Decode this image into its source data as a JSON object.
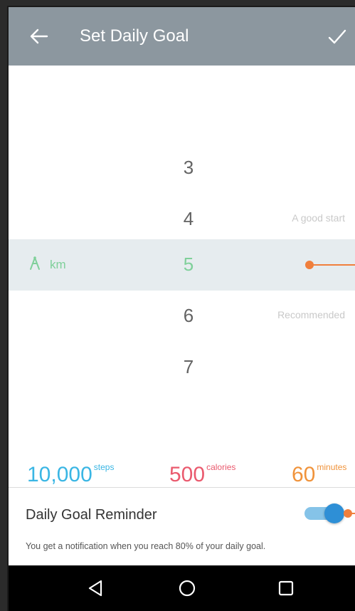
{
  "app_bar": {
    "title": "Set Daily Goal",
    "back_icon": "arrow-left-icon",
    "confirm_icon": "checkmark-icon",
    "background": "#8c979f"
  },
  "picker": {
    "unit_icon": "walker-icon",
    "unit_label": "km",
    "accent": "#7fd09a",
    "rows": [
      {
        "value": "3",
        "hint": ""
      },
      {
        "value": "4",
        "hint": "A good start"
      },
      {
        "value": "5",
        "hint": ""
      },
      {
        "value": "6",
        "hint": "Recommended"
      },
      {
        "value": "7",
        "hint": ""
      }
    ],
    "selected_value": "5"
  },
  "stats": {
    "steps": {
      "value": "10,000",
      "unit": "steps",
      "color": "#3ab6e4"
    },
    "calories": {
      "value": "500",
      "unit": "calories",
      "color": "#ea5a6e"
    },
    "minutes": {
      "value": "60",
      "unit": "minutes",
      "color": "#f0933b"
    }
  },
  "reminder": {
    "title": "Daily Goal Reminder",
    "description": "You get a notification when you reach 80% of your daily goal.",
    "enabled": true,
    "toggle_color": "#2e8fd6"
  },
  "annotation_color": "#f07f3c",
  "nav_bar": {
    "back_icon": "triangle-back-icon",
    "home_icon": "circle-home-icon",
    "recents_icon": "square-recents-icon"
  }
}
